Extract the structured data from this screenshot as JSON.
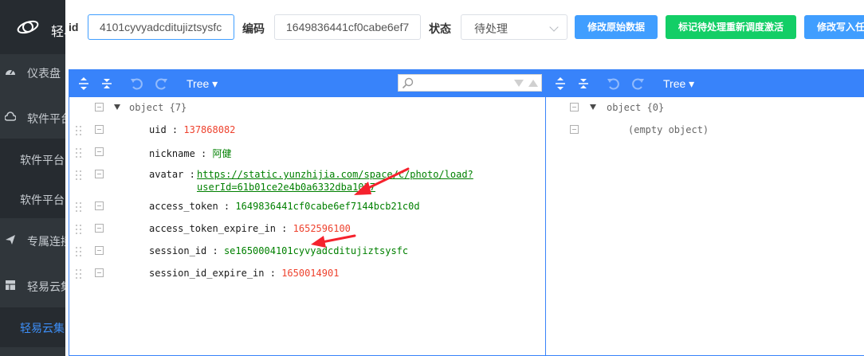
{
  "sidebar": {
    "title": "轻易",
    "items": [
      {
        "label": "仪表盘",
        "icon": "dashboard-icon"
      },
      {
        "label": "软件平台",
        "icon": "cloud-icon"
      },
      {
        "label": "软件平台",
        "icon": ""
      },
      {
        "label": "软件平台",
        "icon": ""
      },
      {
        "label": "专属连接",
        "icon": "paper-plane-icon"
      },
      {
        "label": "轻易云集",
        "icon": "grid-icon"
      },
      {
        "label": "轻易云集",
        "icon": ""
      }
    ]
  },
  "toolbar": {
    "id_label": "id",
    "id_value": "4101cyvyadcditujiztsysfc",
    "code_label": "编码",
    "code_value": "1649836441cf0cabe6ef7",
    "status_label": "状态",
    "status_value": "待处理",
    "buttons": [
      "修改原始数据",
      "标记待处理重新调度激活",
      "修改写入任务"
    ],
    "colors": {
      "primary": "#409eff",
      "success": "#13ce66"
    }
  },
  "editor": {
    "tree_label": "Tree ▾",
    "left": {
      "root_label": "object {7}",
      "rows": [
        {
          "key": "uid",
          "sep": " : ",
          "value": "137868082",
          "type": "number"
        },
        {
          "key": "nickname",
          "sep": " : ",
          "value": "阿健",
          "type": "string"
        },
        {
          "key": "avatar",
          "sep": " : ",
          "value": "https://static.yunzhijia.com/space/c/photo/load?",
          "value2": "userId=61b01ce2e4b0a6332dba1037",
          "type": "url"
        },
        {
          "key": "access_token",
          "sep": " : ",
          "value": "1649836441cf0cabe6ef7144bcb21c0d",
          "type": "string"
        },
        {
          "key": "access_token_expire_in",
          "sep": " : ",
          "value": "1652596100",
          "type": "number"
        },
        {
          "key": "session_id",
          "sep": " : ",
          "value": "se1650004101cyvyadcditujiztsysfc",
          "type": "string"
        },
        {
          "key": "session_id_expire_in",
          "sep": " : ",
          "value": "1650014901",
          "type": "number"
        }
      ]
    },
    "right": {
      "root_label": "object {0}",
      "empty_label": "(empty object)"
    },
    "colors": {
      "menu": "#3883fa",
      "number": "#ee422e",
      "string": "#008000"
    }
  }
}
